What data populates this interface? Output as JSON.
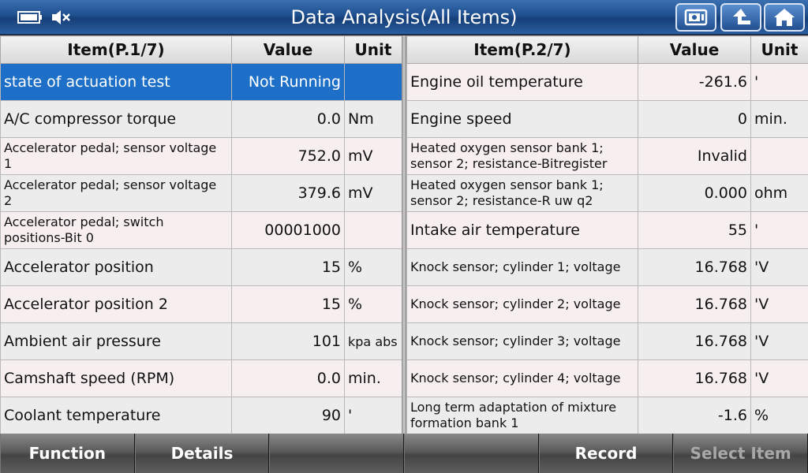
{
  "title": "Data Analysis(All Items)",
  "icons": {
    "battery": "battery-icon",
    "mute": "speaker-mute-icon",
    "screenshot": "camera-card-icon",
    "back": "back-arrow-icon",
    "home": "home-icon"
  },
  "left_table": {
    "headers": {
      "item": "Item(P.1/7)",
      "value": "Value",
      "unit": "Unit"
    },
    "rows": [
      {
        "item": "state of actuation test",
        "value": "Not Running",
        "unit": ""
      },
      {
        "item": "A/C compressor torque",
        "value": "0.0",
        "unit": "Nm"
      },
      {
        "item": "Accelerator pedal; sensor voltage 1",
        "value": "752.0",
        "unit": "mV"
      },
      {
        "item": "Accelerator pedal; sensor voltage 2",
        "value": "379.6",
        "unit": "mV"
      },
      {
        "item": "Accelerator pedal; switch positions-Bit 0",
        "value": "00001000",
        "unit": ""
      },
      {
        "item": "Accelerator position",
        "value": "15",
        "unit": "%"
      },
      {
        "item": "Accelerator position 2",
        "value": "15",
        "unit": "%"
      },
      {
        "item": "Ambient air pressure",
        "value": "101",
        "unit": "kpa abs"
      },
      {
        "item": "Camshaft speed (RPM)",
        "value": "0.0",
        "unit": "min."
      },
      {
        "item": "Coolant temperature",
        "value": "90",
        "unit": "'"
      }
    ]
  },
  "right_table": {
    "headers": {
      "item": "Item(P.2/7)",
      "value": "Value",
      "unit": "Unit"
    },
    "rows": [
      {
        "item": "Engine oil temperature",
        "value": "-261.6",
        "unit": "'"
      },
      {
        "item": "Engine speed",
        "value": "0",
        "unit": "min."
      },
      {
        "item": "Heated oxygen sensor bank 1; sensor 2; resistance-Bitregister",
        "value": "Invalid",
        "unit": ""
      },
      {
        "item": "Heated oxygen sensor bank 1; sensor 2; resistance-R uw q2",
        "value": "0.000",
        "unit": "ohm"
      },
      {
        "item": "Intake air temperature",
        "value": "55",
        "unit": "'"
      },
      {
        "item": "Knock sensor; cylinder 1; voltage",
        "value": "16.768",
        "unit": "'V"
      },
      {
        "item": "Knock sensor; cylinder 2; voltage",
        "value": "16.768",
        "unit": "'V"
      },
      {
        "item": "Knock sensor; cylinder 3; voltage",
        "value": "16.768",
        "unit": "'V"
      },
      {
        "item": "Knock sensor; cylinder 4; voltage",
        "value": "16.768",
        "unit": "'V"
      },
      {
        "item": "Long term adaptation of mixture formation bank 1",
        "value": "-1.6",
        "unit": "%"
      }
    ]
  },
  "bottom_buttons": {
    "function": "Function",
    "details": "Details",
    "empty1": "",
    "empty2": "",
    "record": "Record",
    "select_item": "Select Item"
  },
  "colors": {
    "title_bar": "#1f4f8f",
    "selected_row": "#1e6fc8",
    "button_bar": "#5a5a5a"
  }
}
